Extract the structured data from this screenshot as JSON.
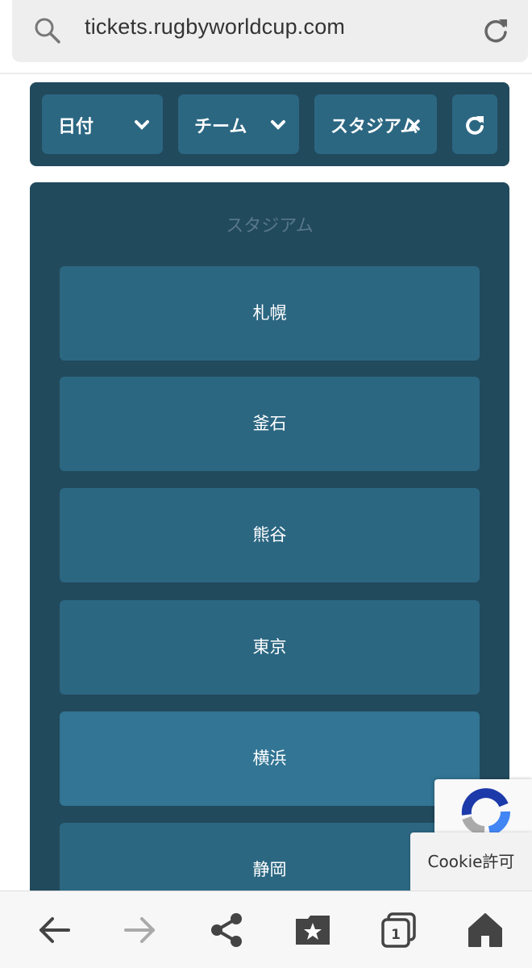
{
  "browser": {
    "url": "tickets.rugbyworldcup.com",
    "search_icon": "search-icon",
    "reload_icon": "reload-icon"
  },
  "filters": {
    "date_label": "日付",
    "team_label": "チーム",
    "stadium_label": "スタジアム",
    "reset_icon": "refresh-icon"
  },
  "stadium_panel": {
    "title": "スタジアム",
    "items": [
      {
        "label": "札幌"
      },
      {
        "label": "釜石"
      },
      {
        "label": "熊谷"
      },
      {
        "label": "東京"
      },
      {
        "label": "横浜"
      },
      {
        "label": "静岡"
      }
    ]
  },
  "overlay": {
    "cookie_label": "Cookie許可",
    "recaptcha_icon": "recaptcha-icon"
  },
  "colors": {
    "panel_bg": "#214a5c",
    "button_bg": "#2c6782",
    "button_highlight": "#327594",
    "panel_title": "#58778a"
  },
  "bottom_nav": [
    "back-icon",
    "forward-icon",
    "share-icon",
    "bookmarks-icon",
    "tabs-icon",
    "home-icon"
  ],
  "tabs_count": "1"
}
